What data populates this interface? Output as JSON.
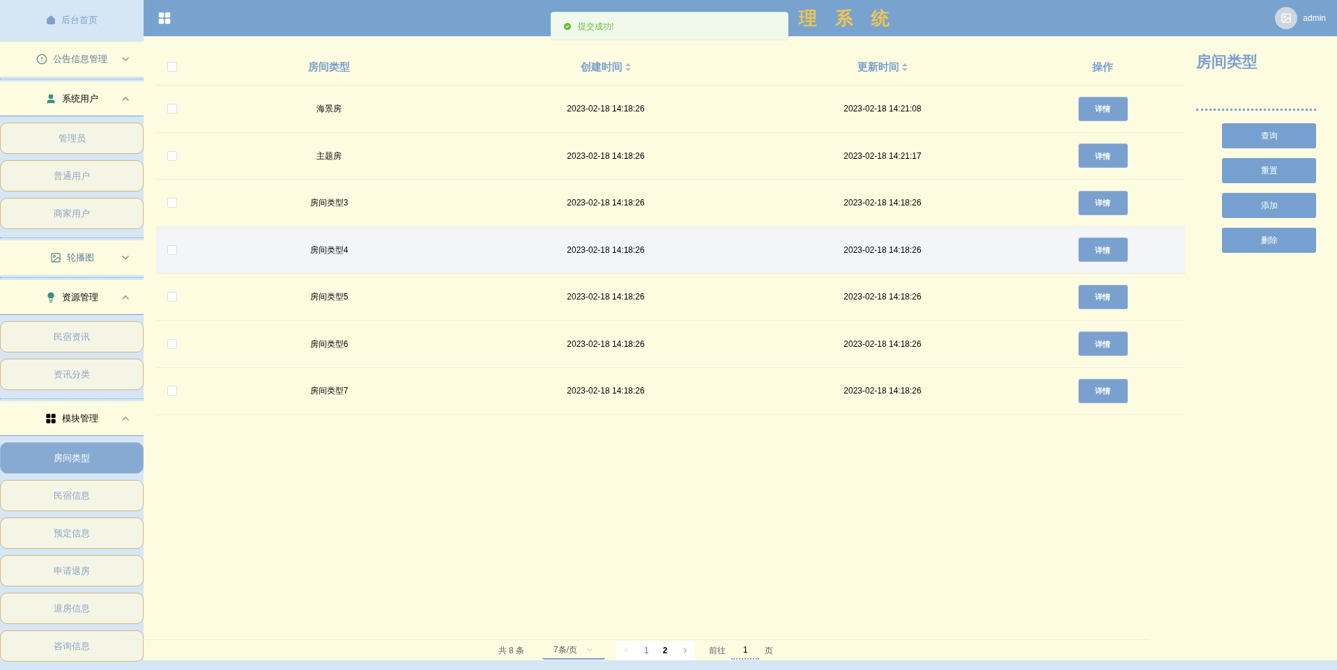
{
  "sidebar": {
    "home": {
      "label": "后台首页"
    },
    "groups": [
      {
        "label": "公告信息管理",
        "expanded": false
      },
      {
        "label": "系统用户",
        "expanded": true,
        "items": [
          {
            "label": "管理员",
            "selected": false
          },
          {
            "label": "普通用户",
            "selected": false
          },
          {
            "label": "商家用户",
            "selected": false
          }
        ]
      },
      {
        "label": "轮播图",
        "expanded": false
      },
      {
        "label": "资源管理",
        "expanded": true,
        "items": [
          {
            "label": "民宿资讯",
            "selected": false
          },
          {
            "label": "资讯分类",
            "selected": false
          }
        ]
      },
      {
        "label": "模块管理",
        "expanded": true,
        "items": [
          {
            "label": "房间类型",
            "selected": true
          },
          {
            "label": "民宿信息",
            "selected": false
          },
          {
            "label": "预定信息",
            "selected": false
          },
          {
            "label": "申请退房",
            "selected": false
          },
          {
            "label": "退房信息",
            "selected": false
          },
          {
            "label": "咨询信息",
            "selected": false
          }
        ]
      }
    ]
  },
  "header": {
    "title_visible": "理系统",
    "user": "admin"
  },
  "toast": {
    "message": "提交成功!"
  },
  "table": {
    "select_all_checked": false,
    "columns": [
      {
        "label": "房间类型",
        "sortable": false
      },
      {
        "label": "创建时间",
        "sortable": true
      },
      {
        "label": "更新时间",
        "sortable": true
      },
      {
        "label": "操作",
        "sortable": false
      }
    ],
    "rows": [
      {
        "checked": false,
        "highlighted": false,
        "type": "海景房",
        "created": "2023-02-18 14:18:26",
        "updated": "2023-02-18 14:21:08",
        "action": "详情"
      },
      {
        "checked": false,
        "highlighted": false,
        "type": "主题房",
        "created": "2023-02-18 14:18:26",
        "updated": "2023-02-18 14:21:17",
        "action": "详情"
      },
      {
        "checked": false,
        "highlighted": false,
        "type": "房间类型3",
        "created": "2023-02-18 14:18:26",
        "updated": "2023-02-18 14:18:26",
        "action": "详情"
      },
      {
        "checked": false,
        "highlighted": true,
        "type": "房间类型4",
        "created": "2023-02-18 14:18:26",
        "updated": "2023-02-18 14:18:26",
        "action": "详情"
      },
      {
        "checked": false,
        "highlighted": false,
        "type": "房间类型5",
        "created": "2023-02-18 14:18:26",
        "updated": "2023-02-18 14:18:26",
        "action": "详情"
      },
      {
        "checked": false,
        "highlighted": false,
        "type": "房间类型6",
        "created": "2023-02-18 14:18:26",
        "updated": "2023-02-18 14:18:26",
        "action": "详情"
      },
      {
        "checked": false,
        "highlighted": false,
        "type": "房间类型7",
        "created": "2023-02-18 14:18:26",
        "updated": "2023-02-18 14:18:26",
        "action": "详情"
      }
    ]
  },
  "pagination": {
    "total": "共 8 条",
    "page_size": "7条/页",
    "pages": [
      {
        "label": "1",
        "selected": true
      },
      {
        "label": "2",
        "selected": false
      }
    ],
    "goto_label": "前往",
    "goto_value": "1",
    "goto_suffix": "页"
  },
  "panel": {
    "title": "房间类型",
    "buttons": [
      "查询",
      "重置",
      "添加",
      "删除"
    ]
  }
}
